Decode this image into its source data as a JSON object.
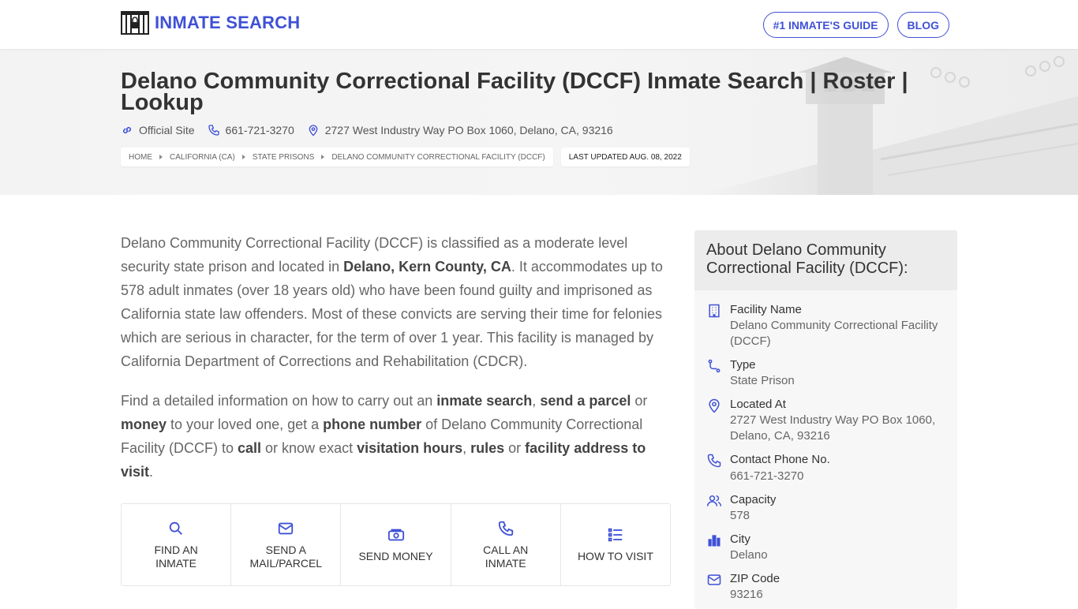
{
  "header": {
    "logo_text": "INMATE SEARCH",
    "nav": [
      "#1 INMATE'S GUIDE",
      "BLOG"
    ]
  },
  "colors": {
    "accent": "#3f51d6",
    "text": "#555555",
    "hero_bg": "#f3f3f3"
  },
  "hero": {
    "title": "Delano Community Correctional Facility (DCCF) Inmate Search | Roster | Lookup",
    "official_site": "Official Site",
    "phone": "661-721-3270",
    "address": "2727 West Industry Way PO Box 1060, Delano, CA, 93216",
    "breadcrumbs": [
      "HOME",
      "CALIFORNIA (CA)",
      "STATE PRISONS",
      "DELANO COMMUNITY CORRECTIONAL FACILITY (DCCF)"
    ],
    "last_updated": "LAST UPDATED AUG. 08, 2022"
  },
  "main": {
    "p1": {
      "a": "Delano Community Correctional Facility (DCCF) is classified as a moderate level security state prison and located in ",
      "b": "Delano, Kern County, CA",
      "c": ". It accommodates up to 578 adult inmates (over 18 years old) who have been found guilty and imprisoned as California state law offenders. Most of these convicts are serving their time for felonies which are serious in character, for the term of over 1 year. This facility is managed by California Department of Corrections and Rehabilitation (CDCR)."
    },
    "p2": {
      "t1": "Find a detailed information on how to carry out an ",
      "b1": "inmate search",
      "t2": ", ",
      "b2": "send a parcel",
      "t3": " or ",
      "b3": "money",
      "t4": " to your loved one, get a ",
      "b4": "phone number",
      "t5": " of Delano Community Correctional Facility (DCCF) to ",
      "b5": "call",
      "t6": " or know exact ",
      "b6": "visitation hours",
      "t7": ", ",
      "b7": "rules",
      "t8": " or ",
      "b8": "facility address to visit",
      "t9": "."
    },
    "actions": [
      {
        "icon": "search-icon",
        "label_1": "FIND AN",
        "label_2": "INMATE"
      },
      {
        "icon": "mail-icon",
        "label_1": "SEND A",
        "label_2": "MAIL/PARCEL"
      },
      {
        "icon": "money-icon",
        "label_1": "SEND MONEY",
        "label_2": ""
      },
      {
        "icon": "phone-icon",
        "label_1": "CALL AN",
        "label_2": "INMATE"
      },
      {
        "icon": "list-icon",
        "label_1": "HOW TO VISIT",
        "label_2": ""
      }
    ]
  },
  "sidebar": {
    "title": "About Delano Community Correctional Facility (DCCF):",
    "items": [
      {
        "icon": "building-icon",
        "label": "Facility Name",
        "value": "Delano Community Correctional Facility (DCCF)"
      },
      {
        "icon": "route-icon",
        "label": "Type",
        "value": "State Prison"
      },
      {
        "icon": "location-icon",
        "label": "Located At",
        "value": "2727 West Industry Way PO Box 1060, Delano, CA, 93216"
      },
      {
        "icon": "phone-icon",
        "label": "Contact Phone No.",
        "value": "661-721-3270"
      },
      {
        "icon": "users-icon",
        "label": "Capacity",
        "value": "578"
      },
      {
        "icon": "city-icon",
        "label": "City",
        "value": "Delano"
      },
      {
        "icon": "mail-icon",
        "label": "ZIP Code",
        "value": "93216"
      }
    ]
  }
}
